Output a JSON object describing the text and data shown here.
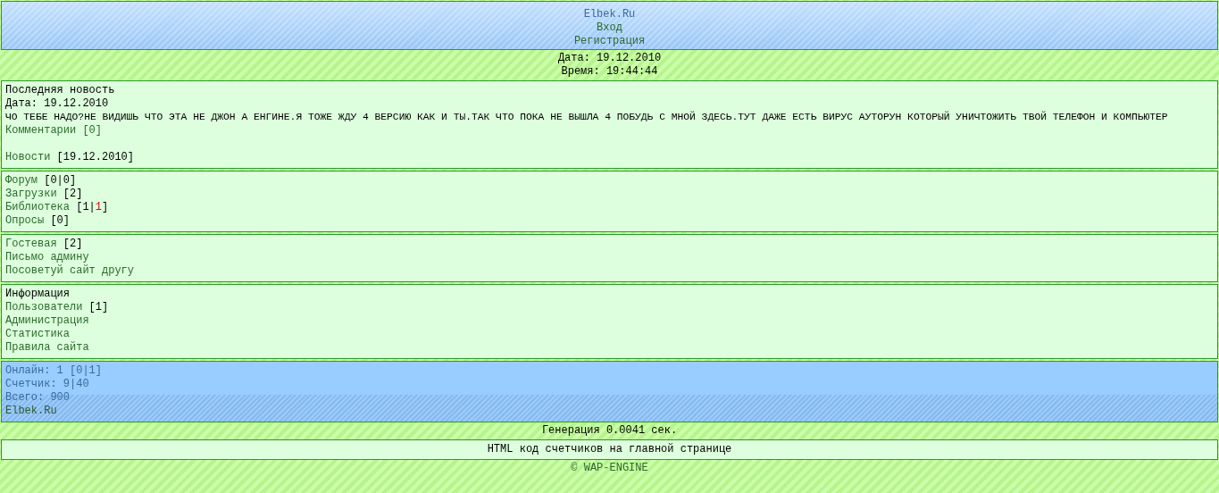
{
  "header": {
    "site_link": "Elbek.Ru",
    "links": [
      "Вход",
      "Регистрация"
    ]
  },
  "datetime": [
    "Дата: 19.12.2010",
    "Время: 19:44:44"
  ],
  "news": {
    "title": "Последняя новость",
    "date": "Дата: 19.12.2010",
    "text": "ЧО ТЕБЕ НАДО?НЕ ВИДИШЬ ЧТО ЭТА НЕ ДЖОН А ЕНГИНЕ.Я ТОЖЕ ЖДУ 4 ВЕРСИЮ КАК И ТЫ.ТАК ЧТО ПОКА НЕ ВЫШЛА 4 ПОБУДЬ С МНОЙ ЗДЕСЬ.ТУТ ДАЖЕ ЕСТЬ ВИРУС АУТОРУН КОТОРЫЙ УНИЧТОЖИТЬ ТВОЙ ТЕЛЕФОН И КОМПЬЮТЕР",
    "comments_link": "Комментарии [0]",
    "archive_link": "Новости",
    "archive_date": "[19.12.2010]"
  },
  "sections": [
    {
      "items": [
        {
          "label": "Форум",
          "count": [
            {
              "text": "[0|0]",
              "new": false
            }
          ]
        },
        {
          "label": "Загрузки",
          "count": [
            {
              "text": "[2]",
              "new": false
            }
          ]
        },
        {
          "label": "Библиотека",
          "count": [
            {
              "text": "[1|",
              "new": false
            },
            {
              "text": "1",
              "new": true
            },
            {
              "text": "]",
              "new": false
            }
          ]
        },
        {
          "label": "Опросы",
          "count": [
            {
              "text": "[0]",
              "new": false
            }
          ]
        }
      ]
    },
    {
      "items": [
        {
          "label": "Гостевая",
          "count": [
            {
              "text": "[2]",
              "new": false
            }
          ]
        },
        {
          "label": "Письмо админу"
        },
        {
          "label": "Посоветуй сайт другу"
        }
      ]
    },
    {
      "heading": "Информация",
      "items": [
        {
          "label": "Пользователи",
          "count": [
            {
              "text": "[1]",
              "new": false
            }
          ]
        },
        {
          "label": "Администрация"
        },
        {
          "label": "Статистика"
        },
        {
          "label": "Правила сайта"
        }
      ]
    }
  ],
  "stats": {
    "lines": [
      "Онлайн: 1 [0|1]",
      "Счетчик: 9|40",
      "Всего: 900"
    ],
    "site_link": "Elbek.Ru"
  },
  "generation": "Генерация 0.0041 сек.",
  "counters_link": "HTML код счетчиков на главной странице",
  "copyright": "© WAP-ENGINE"
}
